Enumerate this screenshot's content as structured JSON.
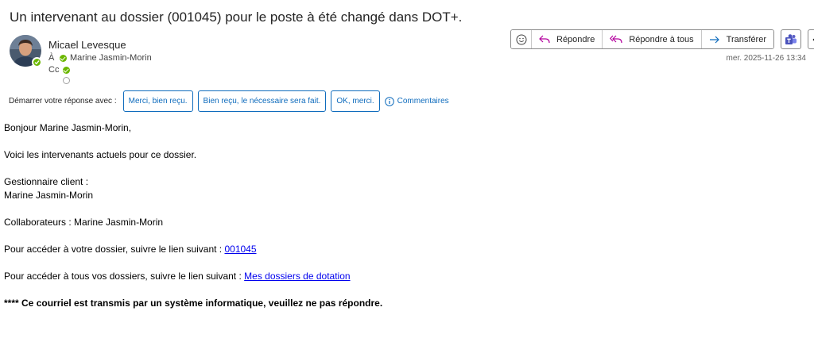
{
  "email": {
    "subject": "Un intervenant au dossier (001045) pour le poste  à été changé dans DOT+.",
    "sender": "Micael Levesque",
    "to_label": "À",
    "to_name": "Marine Jasmin-Morin",
    "cc_label": "Cc",
    "date": "mer. 2025-11-26 13:34"
  },
  "actions": {
    "reply": "Répondre",
    "reply_all": "Répondre à tous",
    "forward": "Transférer"
  },
  "quick_replies": {
    "label": "Démarrer votre réponse avec :",
    "options": [
      "Merci, bien reçu.",
      "Bien reçu, le nécessaire sera fait.",
      "OK, merci."
    ],
    "feedback": "Commentaires"
  },
  "body": {
    "greeting": "Bonjour Marine Jasmin-Morin,",
    "intro": "Voici les intervenants actuels pour ce dossier.",
    "manager_label": "Gestionnaire client :",
    "manager_name": "Marine Jasmin-Morin",
    "collaborators": "Collaborateurs : Marine Jasmin-Morin",
    "link1_text": "Pour accéder à votre dossier, suivre le lien suivant : ",
    "link1_label": "001045",
    "link2_text": "Pour accéder à tous vos dossiers, suivre le lien suivant : ",
    "link2_label": "Mes dossiers de dotation",
    "footer": "**** Ce courriel est transmis par un système informatique, veuillez ne pas répondre."
  },
  "colors": {
    "accent": "#0f6cbd",
    "presence": "#6bb700",
    "reply_icon": "#b4009e",
    "link": "#0000ee"
  }
}
